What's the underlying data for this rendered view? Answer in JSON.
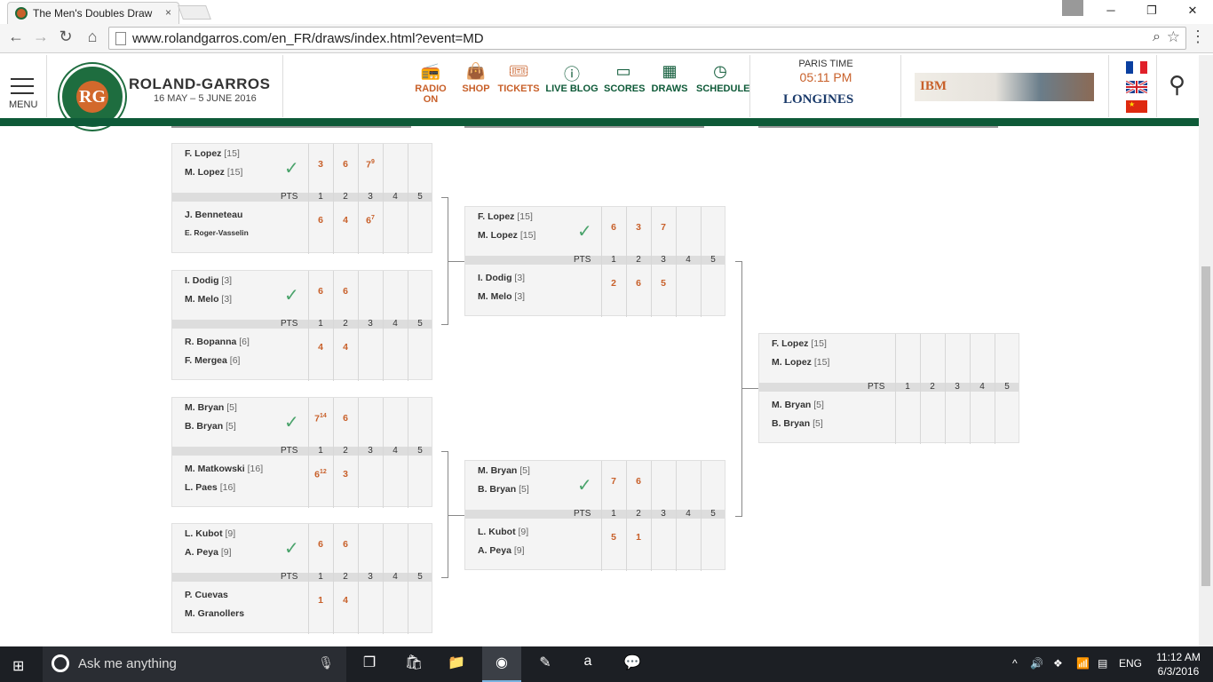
{
  "browser": {
    "tab_title": "The Men's Doubles Draw",
    "tab_close": "×",
    "url": "www.rolandgarros.com/en_FR/draws/index.html?event=MD",
    "minimize": "─",
    "maximize": "❐",
    "close": "✕"
  },
  "header": {
    "menu_label": "MENU",
    "brand": "ROLAND-GARROS",
    "dates": "16 MAY – 5 JUNE 2016",
    "nav": [
      {
        "label": "RADIO ON",
        "icon": "radio-icon"
      },
      {
        "label": "SHOP",
        "icon": "bag-icon"
      },
      {
        "label": "TICKETS",
        "icon": "ticket-icon"
      },
      {
        "label": "LIVE BLOG",
        "icon": "info-icon"
      },
      {
        "label": "SCORES",
        "icon": "scoreboard-icon"
      },
      {
        "label": "DRAWS",
        "icon": "draw-icon"
      },
      {
        "label": "SCHEDULE",
        "icon": "clock-icon"
      }
    ],
    "paris_time_label": "PARIS TIME",
    "paris_time": "05:11 PM",
    "sponsor": "LONGINES",
    "ad_text": "IBM",
    "languages": [
      "French",
      "English",
      "Chinese"
    ]
  },
  "bracket": {
    "pts_label": "PTS",
    "set_numbers": [
      "1",
      "2",
      "3",
      "4",
      "5"
    ],
    "round1": [
      {
        "top": [
          {
            "name": "F. Lopez",
            "seed": "[15]"
          },
          {
            "name": "M. Lopez",
            "seed": "[15]"
          }
        ],
        "bottom": [
          {
            "name": "J. Benneteau",
            "seed": ""
          },
          {
            "name": "E. Roger-Vasselin",
            "seed": ""
          }
        ],
        "winner": "top",
        "top_scores": [
          {
            "v": "3"
          },
          {
            "v": "6"
          },
          {
            "v": "7",
            "tb": "9"
          }
        ],
        "bottom_scores": [
          {
            "v": "6"
          },
          {
            "v": "4"
          },
          {
            "v": "6",
            "tb": "7"
          }
        ]
      },
      {
        "top": [
          {
            "name": "I. Dodig",
            "seed": "[3]"
          },
          {
            "name": "M. Melo",
            "seed": "[3]"
          }
        ],
        "bottom": [
          {
            "name": "R. Bopanna",
            "seed": "[6]"
          },
          {
            "name": "F. Mergea",
            "seed": "[6]"
          }
        ],
        "winner": "top",
        "top_scores": [
          {
            "v": "6"
          },
          {
            "v": "6"
          }
        ],
        "bottom_scores": [
          {
            "v": "4"
          },
          {
            "v": "4"
          }
        ]
      },
      {
        "top": [
          {
            "name": "M. Bryan",
            "seed": "[5]"
          },
          {
            "name": "B. Bryan",
            "seed": "[5]"
          }
        ],
        "bottom": [
          {
            "name": "M. Matkowski",
            "seed": "[16]"
          },
          {
            "name": "L. Paes",
            "seed": "[16]"
          }
        ],
        "winner": "top",
        "top_scores": [
          {
            "v": "7",
            "tb": "14"
          },
          {
            "v": "6"
          }
        ],
        "bottom_scores": [
          {
            "v": "6",
            "tb": "12"
          },
          {
            "v": "3"
          }
        ]
      },
      {
        "top": [
          {
            "name": "L. Kubot",
            "seed": "[9]"
          },
          {
            "name": "A. Peya",
            "seed": "[9]"
          }
        ],
        "bottom": [
          {
            "name": "P. Cuevas",
            "seed": ""
          },
          {
            "name": "M. Granollers",
            "seed": ""
          }
        ],
        "winner": "top",
        "top_scores": [
          {
            "v": "6"
          },
          {
            "v": "6"
          }
        ],
        "bottom_scores": [
          {
            "v": "1"
          },
          {
            "v": "4"
          }
        ]
      }
    ],
    "round2": [
      {
        "top": [
          {
            "name": "F. Lopez",
            "seed": "[15]"
          },
          {
            "name": "M. Lopez",
            "seed": "[15]"
          }
        ],
        "bottom": [
          {
            "name": "I. Dodig",
            "seed": "[3]"
          },
          {
            "name": "M. Melo",
            "seed": "[3]"
          }
        ],
        "winner": "top",
        "top_scores": [
          {
            "v": "6"
          },
          {
            "v": "3"
          },
          {
            "v": "7"
          }
        ],
        "bottom_scores": [
          {
            "v": "2"
          },
          {
            "v": "6"
          },
          {
            "v": "5"
          }
        ]
      },
      {
        "top": [
          {
            "name": "M. Bryan",
            "seed": "[5]"
          },
          {
            "name": "B. Bryan",
            "seed": "[5]"
          }
        ],
        "bottom": [
          {
            "name": "L. Kubot",
            "seed": "[9]"
          },
          {
            "name": "A. Peya",
            "seed": "[9]"
          }
        ],
        "winner": "top",
        "top_scores": [
          {
            "v": "7"
          },
          {
            "v": "6"
          }
        ],
        "bottom_scores": [
          {
            "v": "5"
          },
          {
            "v": "1"
          }
        ]
      }
    ],
    "round3": [
      {
        "top": [
          {
            "name": "F. Lopez",
            "seed": "[15]"
          },
          {
            "name": "M. Lopez",
            "seed": "[15]"
          }
        ],
        "bottom": [
          {
            "name": "M. Bryan",
            "seed": "[5]"
          },
          {
            "name": "B. Bryan",
            "seed": "[5]"
          }
        ],
        "winner": "",
        "top_scores": [],
        "bottom_scores": []
      }
    ]
  },
  "taskbar": {
    "search_placeholder": "Ask me anything",
    "language": "ENG",
    "time": "11:12 AM",
    "date": "6/3/2016"
  }
}
